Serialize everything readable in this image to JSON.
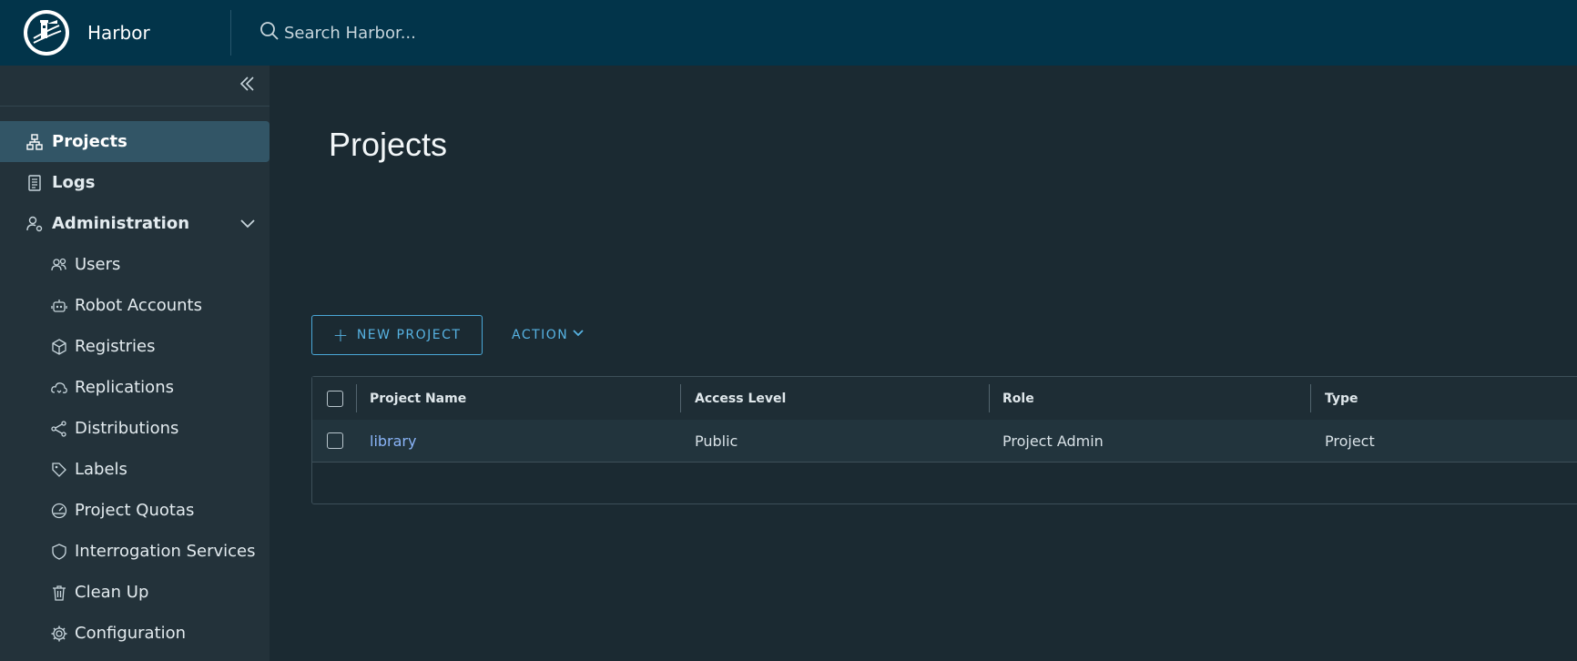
{
  "header": {
    "app_name": "Harbor",
    "search_placeholder": "Search Harbor..."
  },
  "sidebar": {
    "collapse_icon": "double-chevron-left-icon",
    "items": [
      {
        "label": "Projects",
        "icon": "projects-icon",
        "active": true
      },
      {
        "label": "Logs",
        "icon": "logs-icon"
      },
      {
        "label": "Administration",
        "icon": "administration-icon",
        "expanded": true
      },
      {
        "label": "Users",
        "icon": "users-icon"
      },
      {
        "label": "Robot Accounts",
        "icon": "robot-icon"
      },
      {
        "label": "Registries",
        "icon": "registries-icon"
      },
      {
        "label": "Replications",
        "icon": "replications-icon"
      },
      {
        "label": "Distributions",
        "icon": "distributions-icon"
      },
      {
        "label": "Labels",
        "icon": "labels-icon"
      },
      {
        "label": "Project Quotas",
        "icon": "quotas-icon"
      },
      {
        "label": "Interrogation Services",
        "icon": "shield-icon"
      },
      {
        "label": "Clean Up",
        "icon": "trash-icon"
      },
      {
        "label": "Configuration",
        "icon": "gear-icon"
      }
    ]
  },
  "main": {
    "title": "Projects",
    "new_project_label": "NEW PROJECT",
    "action_label": "ACTION",
    "table": {
      "columns": [
        "Project Name",
        "Access Level",
        "Role",
        "Type"
      ],
      "rows": [
        {
          "name": "library",
          "access": "Public",
          "role": "Project Admin",
          "type": "Project"
        }
      ]
    }
  },
  "colors": {
    "header_bg": "#02344a",
    "sidebar_bg": "#23323a",
    "active_item_bg": "#325566",
    "accent": "#57b3e3",
    "link": "#8ab4f8"
  }
}
